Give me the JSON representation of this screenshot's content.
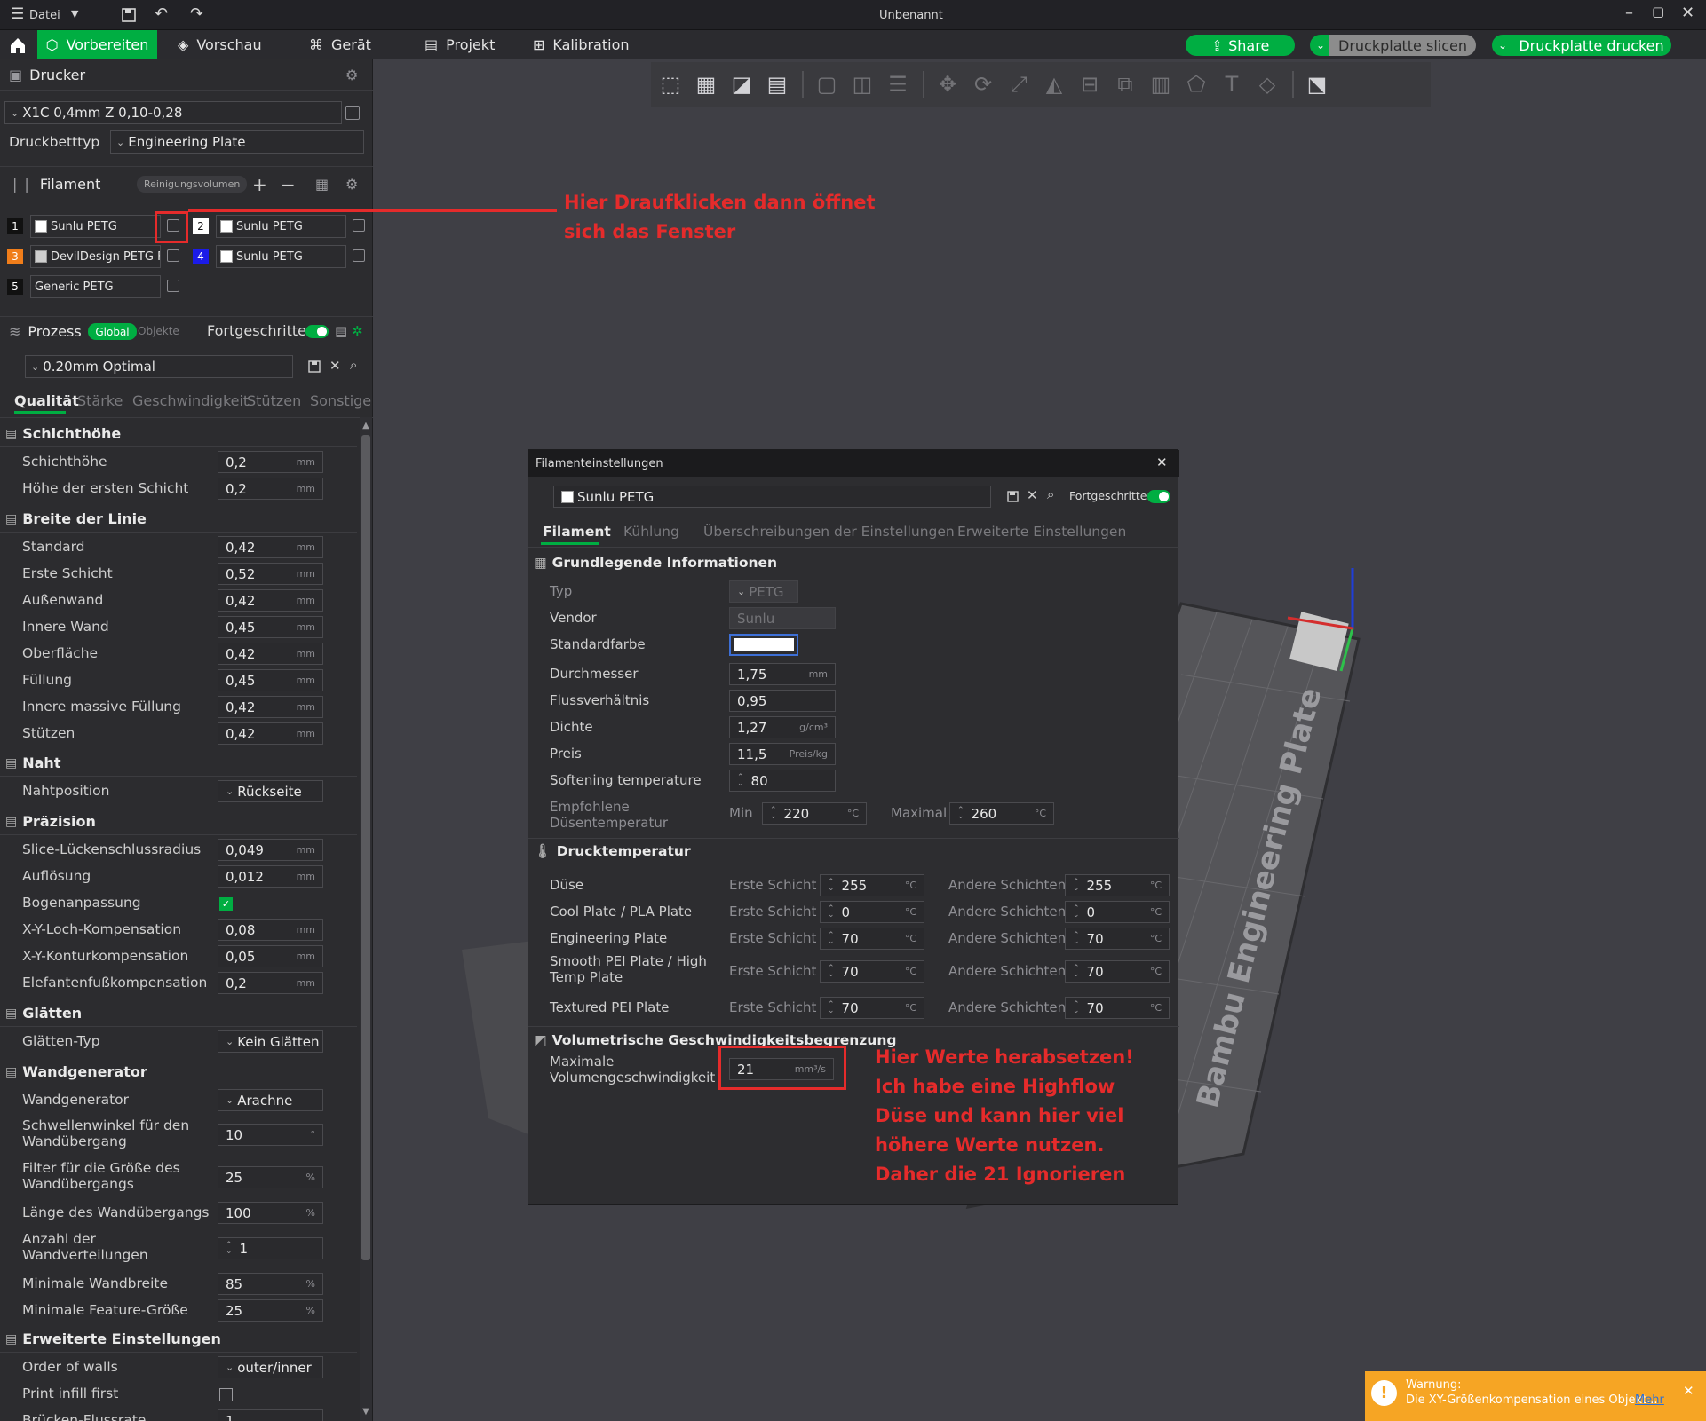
{
  "titlebar": {
    "menu": "Datei",
    "title": "Unbenannt"
  },
  "tabs": [
    "Vorbereiten",
    "Vorschau",
    "Gerät",
    "Projekt",
    "Kalibration"
  ],
  "actions": {
    "share": "Share",
    "slice": "Druckplatte slicen",
    "print": "Druckplatte drucken"
  },
  "printer": {
    "header": "Drucker",
    "preset": "X1C 0,4mm Z 0,10-0,28",
    "bed_label": "Druckbetttyp",
    "bed_value": "Engineering Plate"
  },
  "filament": {
    "header": "Filament",
    "purge_btn": "Reinigungsvolumen",
    "slots": [
      {
        "num": "1",
        "name": "Sunlu PETG",
        "badge": "#111111",
        "swatch": "#ffffff"
      },
      {
        "num": "2",
        "name": "Sunlu PETG",
        "badge": "#ffffff",
        "swatch": "#ffffff"
      },
      {
        "num": "3",
        "name": "DevilDesign PETG F...",
        "badge": "#f07d1a",
        "swatch": "#cfcfcf"
      },
      {
        "num": "4",
        "name": "Sunlu PETG",
        "badge": "#1b1be8",
        "swatch": "#ffffff"
      },
      {
        "num": "5",
        "name": "Generic PETG",
        "badge": "#111111",
        "swatch": ""
      }
    ]
  },
  "process": {
    "header": "Prozess",
    "global": "Global",
    "objects": "Objekte",
    "advanced": "Fortgeschritten",
    "preset": "0.20mm Optimal",
    "tabs": [
      "Qualität",
      "Stärke",
      "Geschwindigkeit",
      "Stützen",
      "Sonstige"
    ]
  },
  "groups": {
    "layer": {
      "title": "Schichthöhe",
      "rows": [
        {
          "label": "Schichthöhe",
          "value": "0,2",
          "unit": "mm"
        },
        {
          "label": "Höhe der ersten Schicht",
          "value": "0,2",
          "unit": "mm"
        }
      ]
    },
    "line": {
      "title": "Breite der Linie",
      "rows": [
        {
          "label": "Standard",
          "value": "0,42",
          "unit": "mm"
        },
        {
          "label": "Erste Schicht",
          "value": "0,52",
          "unit": "mm"
        },
        {
          "label": "Außenwand",
          "value": "0,42",
          "unit": "mm"
        },
        {
          "label": "Innere Wand",
          "value": "0,45",
          "unit": "mm"
        },
        {
          "label": "Oberfläche",
          "value": "0,42",
          "unit": "mm"
        },
        {
          "label": "Füllung",
          "value": "0,45",
          "unit": "mm"
        },
        {
          "label": "Innere massive Füllung",
          "value": "0,42",
          "unit": "mm"
        },
        {
          "label": "Stützen",
          "value": "0,42",
          "unit": "mm"
        }
      ]
    },
    "seam": {
      "title": "Naht",
      "label": "Nahtposition",
      "value": "Rückseite"
    },
    "precision": {
      "title": "Präzision",
      "rows": [
        {
          "label": "Slice-Lückenschlussradius",
          "value": "0,049",
          "unit": "mm"
        },
        {
          "label": "Auflösung",
          "value": "0,012",
          "unit": "mm"
        }
      ],
      "arc_label": "Bogenanpassung",
      "rows2": [
        {
          "label": "X-Y-Loch-Kompensation",
          "value": "0,08",
          "unit": "mm"
        },
        {
          "label": "X-Y-Konturkompensation",
          "value": "0,05",
          "unit": "mm"
        },
        {
          "label": "Elefantenfußkompensation",
          "value": "0,2",
          "unit": "mm"
        }
      ]
    },
    "ironing": {
      "title": "Glätten",
      "label": "Glätten-Typ",
      "value": "Kein Glätten"
    },
    "wallgen": {
      "title": "Wandgenerator",
      "label": "Wandgenerator",
      "value": "Arachne",
      "threshold_l1": "Schwellenwinkel für den",
      "threshold_l2": "Wandübergang",
      "threshold_v": "10",
      "threshold_u": "°",
      "filter_l1": "Filter für die Größe des",
      "filter_l2": "Wandübergangs",
      "filter_v": "25",
      "filter_u": "%",
      "length_l": "Länge des Wandübergangs",
      "length_v": "100",
      "length_u": "%",
      "count_l1": "Anzahl der",
      "count_l2": "Wandverteilungen",
      "count_v": "1",
      "minwall_l": "Minimale Wandbreite",
      "minwall_v": "85",
      "minwall_u": "%",
      "minfeat_l": "Minimale Feature-Größe",
      "minfeat_v": "25",
      "minfeat_u": "%"
    },
    "advanced": {
      "title": "Erweiterte Einstellungen",
      "walls_l": "Order of walls",
      "walls_v": "outer/inner",
      "infill_l": "Print infill first",
      "bridge_l": "Brücken-Flussrate",
      "bridge_v": "1"
    }
  },
  "dialog": {
    "title": "Filamenteinstellungen",
    "preset": "Sunlu PETG",
    "advanced": "Fortgeschritten",
    "tabs": [
      "Filament",
      "Kühlung",
      "Überschreibungen der Einstellungen",
      "Erweiterte Einstellungen"
    ],
    "basic": {
      "title": "Grundlegende Informationen",
      "type_l": "Typ",
      "type_v": "PETG",
      "vendor_l": "Vendor",
      "vendor_v": "Sunlu",
      "color_l": "Standardfarbe",
      "diam_l": "Durchmesser",
      "diam_v": "1,75",
      "diam_u": "mm",
      "flow_l": "Flussverhältnis",
      "flow_v": "0,95",
      "dens_l": "Dichte",
      "dens_v": "1,27",
      "dens_u": "g/cm³",
      "price_l": "Preis",
      "price_v": "11,5",
      "price_u": "Preis/kg",
      "soft_l": "Softening temperature",
      "soft_v": "80",
      "noz_l1": "Empfohlene",
      "noz_l2": "Düsentemperatur",
      "min_l": "Min",
      "min_v": "220",
      "max_l": "Maximal",
      "max_v": "260",
      "deg": "°C"
    },
    "temp": {
      "title": "Drucktemperatur",
      "first": "Erste Schicht",
      "other": "Andere Schichten",
      "rows": [
        {
          "label": "Düse",
          "first": "255",
          "other": "255"
        },
        {
          "label": "Cool Plate / PLA Plate",
          "first": "0",
          "other": "0"
        },
        {
          "label": "Engineering Plate",
          "first": "70",
          "other": "70"
        },
        {
          "label": "Smooth PEI Plate / High Temp Plate",
          "first": "70",
          "other": "70"
        },
        {
          "label": "Textured PEI Plate",
          "first": "70",
          "other": "70"
        }
      ]
    },
    "vol": {
      "title": "Volumetrische Geschwindigkeitsbegrenzung",
      "l1": "Maximale",
      "l2": "Volumengeschwindigkeit",
      "value": "21",
      "unit": "mm³/s"
    }
  },
  "plate_label": "Bambu Engineering Plate",
  "annotations": {
    "top_l1": "Hier Draufklicken dann öffnet",
    "top_l2": "sich das Fenster",
    "bottom": [
      "Hier Werte herabsetzen!",
      "Ich habe eine Highflow",
      "Düse und kann hier viel",
      "höhere Werte nutzen.",
      "Daher die 21 Ignorieren"
    ]
  },
  "warning": {
    "title": "Warnung:",
    "text": "Die XY-Größenkompensation eines Objekt...",
    "link": "Mehr"
  },
  "colors": {
    "accent": "#00ae42",
    "annotation": "#e52b2b"
  }
}
